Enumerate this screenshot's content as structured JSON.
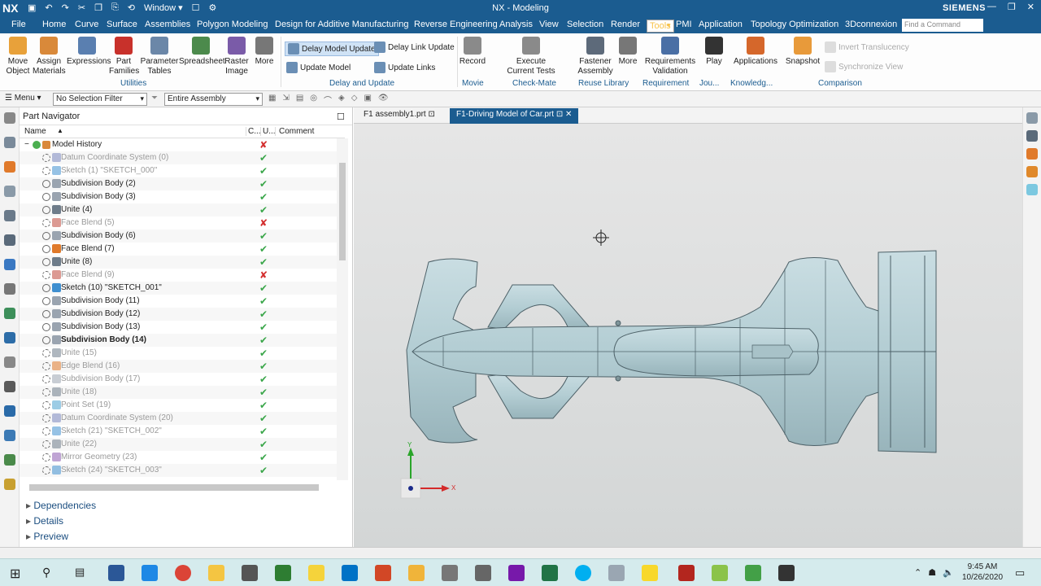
{
  "window": {
    "logo": "NX",
    "title": "NX - Modeling",
    "brand": "SIEMENS",
    "quick_window": "Window ▾"
  },
  "menu": {
    "items": [
      "File",
      "Home",
      "Curve",
      "Surface",
      "Assemblies",
      "Polygon Modeling",
      "Design for Additive Manufacturing",
      "Reverse Engineering",
      "Analysis",
      "View",
      "Selection",
      "Render",
      "Tools",
      "PMI",
      "Application",
      "Topology Optimization",
      "3Dconnexion"
    ],
    "selected": "Tools",
    "find_placeholder": "Find a Command"
  },
  "ribbon": {
    "buttons": [
      {
        "label": "Move\nObject",
        "icon": "move-object-icon",
        "color": "#e8a13a"
      },
      {
        "label": "Assign\nMaterials",
        "icon": "materials-icon",
        "color": "#d9893a"
      },
      {
        "label": "Expressions",
        "icon": "expressions-icon",
        "color": "#5a7fb0"
      },
      {
        "label": "Part\nFamilies",
        "icon": "part-families-icon",
        "color": "#c8312b"
      },
      {
        "label": "Parameter\nTables",
        "icon": "parameter-tables-icon",
        "color": "#6b87a8"
      },
      {
        "label": "Spreadsheet",
        "icon": "spreadsheet-icon",
        "color": "#4c8a4c"
      },
      {
        "label": "Raster\nImage",
        "icon": "raster-image-icon",
        "color": "#7a5ba8"
      },
      {
        "label": "More",
        "icon": "more-icon",
        "color": "#777777"
      },
      {
        "label": "Record",
        "icon": "record-icon",
        "color": "#8a8a8a"
      },
      {
        "label": "Execute\nCurrent Tests",
        "icon": "execute-tests-icon",
        "color": "#8a8a8a"
      },
      {
        "label": "Fastener\nAssembly",
        "icon": "fastener-icon",
        "color": "#5d6a7a"
      },
      {
        "label": "More",
        "icon": "more-icon",
        "color": "#777777"
      },
      {
        "label": "Requirements\nValidation",
        "icon": "requirements-icon",
        "color": "#4a6fa5"
      },
      {
        "label": "Play",
        "icon": "play-icon",
        "color": "#333333"
      },
      {
        "label": "Applications",
        "icon": "applications-icon",
        "color": "#d5672b"
      },
      {
        "label": "Snapshot",
        "icon": "snapshot-icon",
        "color": "#e89a3a"
      }
    ],
    "small": {
      "delay_model_update": "Delay Model Update",
      "update_model": "Update Model",
      "delay_link_update": "Delay Link Update",
      "update_links": "Update Links",
      "invert_translucency": "Invert Translucency",
      "synchronize_view": "Synchronize View"
    },
    "groups": [
      "Utilities",
      "Delay and Update",
      "Movie",
      "Check-Mate",
      "Reuse Library",
      "Requirement",
      "Jou...",
      "Knowledg...",
      "Comparison"
    ]
  },
  "toolbar": {
    "menu": "Menu",
    "selection_filter": "No Selection Filter",
    "scope": "Entire Assembly"
  },
  "navigator": {
    "title": "Part Navigator",
    "columns": [
      "Name",
      "C...",
      "U...",
      "Comment"
    ],
    "root": "Model History",
    "rows": [
      {
        "name": "Datum Coordinate System (0)",
        "status": "✔",
        "active": false
      },
      {
        "name": "Sketch (1) \"SKETCH_000\"",
        "status": "✔",
        "active": false
      },
      {
        "name": "Subdivision Body (2)",
        "status": "✔",
        "active": true
      },
      {
        "name": "Subdivision Body (3)",
        "status": "✔",
        "active": true
      },
      {
        "name": "Unite (4)",
        "status": "✔",
        "active": true
      },
      {
        "name": "Face Blend (5)",
        "status": "✘",
        "active": false
      },
      {
        "name": "Subdivision Body (6)",
        "status": "✔",
        "active": true
      },
      {
        "name": "Face Blend (7)",
        "status": "✔",
        "active": true
      },
      {
        "name": "Unite (8)",
        "status": "✔",
        "active": true
      },
      {
        "name": "Face Blend (9)",
        "status": "✘",
        "active": false
      },
      {
        "name": "Sketch (10) \"SKETCH_001\"",
        "status": "✔",
        "active": true
      },
      {
        "name": "Subdivision Body (11)",
        "status": "✔",
        "active": true
      },
      {
        "name": "Subdivision Body (12)",
        "status": "✔",
        "active": true
      },
      {
        "name": "Subdivision Body (13)",
        "status": "✔",
        "active": true
      },
      {
        "name": "Subdivision Body (14)",
        "status": "✔",
        "active": true,
        "bold": true
      },
      {
        "name": "Unite (15)",
        "status": "✔",
        "active": false
      },
      {
        "name": "Edge Blend (16)",
        "status": "✔",
        "active": false
      },
      {
        "name": "Subdivision Body (17)",
        "status": "✔",
        "active": false
      },
      {
        "name": "Unite (18)",
        "status": "✔",
        "active": false
      },
      {
        "name": "Point Set (19)",
        "status": "✔",
        "active": false
      },
      {
        "name": "Datum Coordinate System (20)",
        "status": "✔",
        "active": false
      },
      {
        "name": "Sketch (21) \"SKETCH_002\"",
        "status": "✔",
        "active": false
      },
      {
        "name": "Unite (22)",
        "status": "✔",
        "active": false
      },
      {
        "name": "Mirror Geometry (23)",
        "status": "✔",
        "active": false
      },
      {
        "name": "Sketch (24) \"SKETCH_003\"",
        "status": "✔",
        "active": false
      }
    ],
    "panels": [
      "Dependencies",
      "Details",
      "Preview"
    ]
  },
  "tabs": [
    {
      "label": "F1 assembly1.prt",
      "active": false
    },
    {
      "label": "F1-Driving Model of Car.prt",
      "active": true
    }
  ],
  "viewport": {
    "axis_x": "X",
    "axis_y": "Y"
  },
  "taskbar": {
    "time": "9:45 AM",
    "date": "10/26/2020"
  }
}
